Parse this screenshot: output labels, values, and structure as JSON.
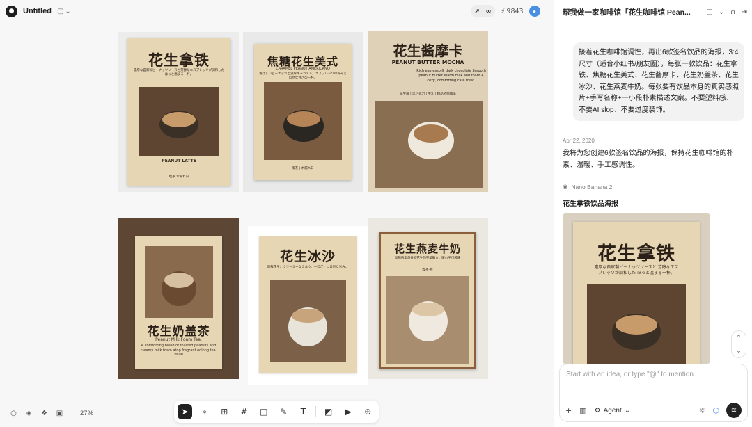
{
  "header": {
    "doc_title": "Untitled",
    "credits": "9843"
  },
  "posters": [
    {
      "title": "花生拿铁",
      "subtitle": "濃厚な自家製ピーナッツソースと芳醇なエスプレッソが調和した ほっと温まる一杯。",
      "english": "PEANUT LATTE",
      "footer": "喫茶 木漏れ日"
    },
    {
      "title": "焦糖花生美式",
      "subtitle": "CARAMEL PEANUT AMERICANO",
      "english": "香ばしいピーナッツと濃厚キャラメル。エスプレッソの深みと自然な甘さの一杯。",
      "footer": "喫茶 | 木漏れ日"
    },
    {
      "title": "花生酱摩卡",
      "subtitle": "PEANUT BUTTER MOCHA",
      "english": "Rich espresso & dark chocolate Smooth peanut butter Warm milk and foam A cozy, comforting cafe treat.",
      "footer": "花生酱 | 黑巧克力 | 牛乳 | 精品浓缩咖啡"
    },
    {
      "title": "花生奶盖茶",
      "subtitle": "Peanut Milk Foam Tea.",
      "english": "A comforting blend of roasted peanuts and creamy milk foam atop fragrant oolong tea. ¥600",
      "footer": ""
    },
    {
      "title": "花生冰沙",
      "subtitle": "新鮮花生とクリーミーなミルク、一口ごとに自然な甘み。",
      "english": "",
      "footer": ""
    },
    {
      "title": "花生燕麦牛奶",
      "subtitle": "温和燕麦与香醇花生的完美融合，暖心手作风味",
      "english": "",
      "footer": "喫茶·燕"
    }
  ],
  "canvas": {
    "zoom": "27%"
  },
  "chat": {
    "title": "帮我做一家咖啡馆「花生咖啡馆 Pean...",
    "user_message": "接着花生咖啡馆调性，再出6款签名饮品的海报，3:4尺寸（适合小红书/朋友圈），每张一款饮品：花生拿铁、焦糖花生美式、花生酱摩卡、花生奶盖茶、花生冰沙、花生燕麦牛奶。每张要有饮品本身的真实感照片+手写名称+一小段朴素描述文案。不要塑料感、不要AI slop、不要过度装饰。",
    "date": "Apr 22, 2020",
    "bot_message": "我将为您创建6款签名饮品的海报，保持花生咖啡馆的朴素、温暖、手工感调性。",
    "model": "Nano Banana 2",
    "result_title": "花生拿铁饮品海报",
    "result_poster_title": "花生拿铁",
    "result_poster_sub": "濃厚な自家製ピーナッツソースと 芳醇なエスプレッソが調和した ほっと温まる一杯。",
    "composer_placeholder": "Start with an idea, or type \"@\" to mention",
    "agent_label": "Agent"
  },
  "colors": {
    "paper": "#e6d6b4",
    "coffee": "#6b4f35",
    "accent_blue": "#4a90e2"
  }
}
